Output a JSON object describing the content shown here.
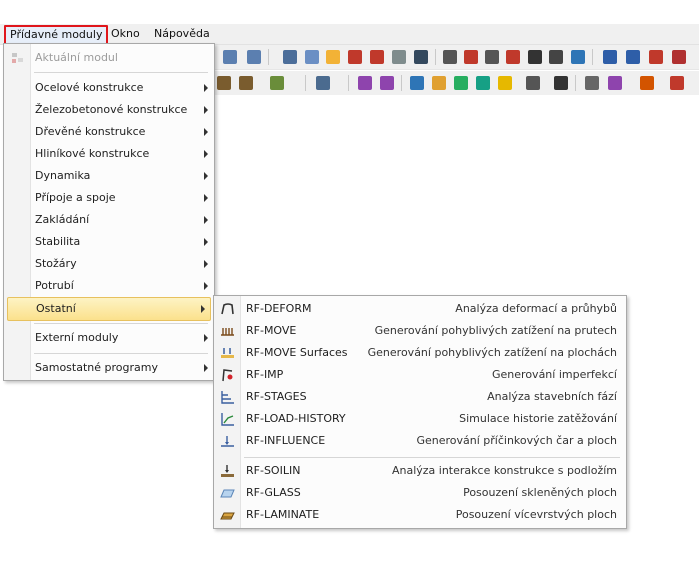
{
  "menubar": {
    "items": [
      {
        "label": "Přídavné moduly"
      },
      {
        "label": "Okno"
      },
      {
        "label": "Nápověda"
      }
    ]
  },
  "colors": {
    "highlight_top": "#fdf3c4",
    "highlight_bottom": "#fbe18c",
    "active_border": "#e0151b"
  },
  "main_menu": {
    "items": [
      {
        "label": "Aktuální modul",
        "disabled": true,
        "icon": "module-icon"
      },
      {
        "label": "Ocelové konstrukce",
        "submenu": true
      },
      {
        "label": "Železobetonové konstrukce",
        "submenu": true
      },
      {
        "label": "Dřevěné konstrukce",
        "submenu": true
      },
      {
        "label": "Hliníkové konstrukce",
        "submenu": true
      },
      {
        "label": "Dynamika",
        "submenu": true
      },
      {
        "label": "Přípoje a spoje",
        "submenu": true
      },
      {
        "label": "Zakládání",
        "submenu": true
      },
      {
        "label": "Stabilita",
        "submenu": true
      },
      {
        "label": "Stožáry",
        "submenu": true
      },
      {
        "label": "Potrubí",
        "submenu": true
      },
      {
        "label": "Ostatní",
        "submenu": true,
        "highlighted": true
      },
      {
        "label": "Externí moduly",
        "submenu": true
      },
      {
        "label": "Samostatné programy",
        "submenu": true
      }
    ]
  },
  "sub_menu": {
    "items": [
      {
        "label": "RF-DEFORM",
        "desc": "Analýza deformací a průhybů",
        "icon": "deform-icon"
      },
      {
        "label": "RF-MOVE",
        "desc": "Generování pohyblivých zatížení na prutech",
        "icon": "move-icon"
      },
      {
        "label": "RF-MOVE Surfaces",
        "desc": "Generování pohyblivých zatížení na plochách",
        "icon": "move-surfaces-icon"
      },
      {
        "label": "RF-IMP",
        "desc": "Generování imperfekcí",
        "icon": "imp-icon"
      },
      {
        "label": "RF-STAGES",
        "desc": "Analýza stavebních fází",
        "icon": "stages-icon"
      },
      {
        "label": "RF-LOAD-HISTORY",
        "desc": "Simulace historie zatěžování",
        "icon": "load-history-icon"
      },
      {
        "label": "RF-INFLUENCE",
        "desc": "Generování příčinkových čar a ploch",
        "icon": "influence-icon"
      },
      {
        "label": "RF-SOILIN",
        "desc": "Analýza interakce konstrukce s podložím",
        "icon": "soilin-icon"
      },
      {
        "label": "RF-GLASS",
        "desc": "Posouzení skleněných ploch",
        "icon": "glass-icon"
      },
      {
        "label": "RF-LAMINATE",
        "desc": "Posouzení vícevrstvých ploch",
        "icon": "laminate-icon"
      }
    ]
  }
}
